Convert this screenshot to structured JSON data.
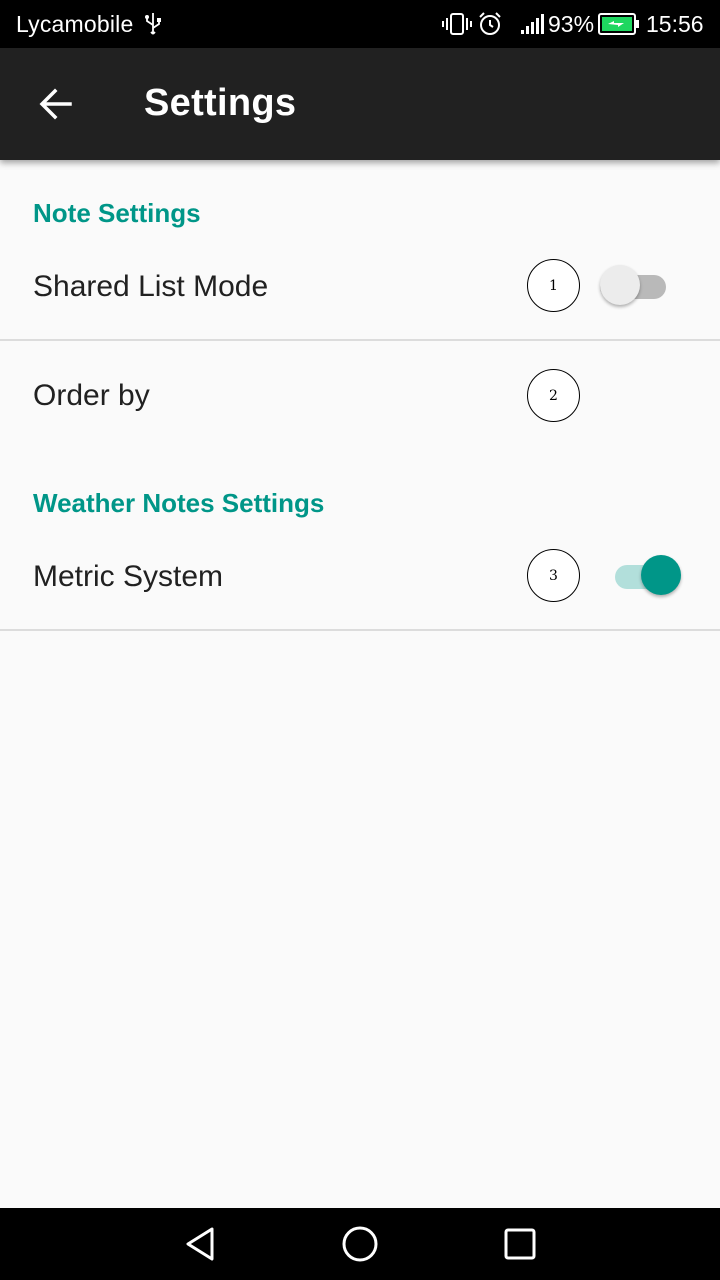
{
  "status_bar": {
    "carrier": "Lycamobile",
    "battery_percent": "93%",
    "time": "15:56",
    "icons": [
      "usb-icon",
      "vibrate-icon",
      "alarm-icon",
      "signal-icon",
      "battery-charging-icon"
    ]
  },
  "app_bar": {
    "back_icon": "arrow-back-icon",
    "title": "Settings"
  },
  "sections": {
    "note": {
      "header": "Note Settings",
      "shared_list_mode": {
        "label": "Shared List Mode",
        "marker": "1",
        "enabled": false
      },
      "order_by": {
        "label": "Order by",
        "marker": "2"
      }
    },
    "weather": {
      "header": "Weather Notes Settings",
      "metric_system": {
        "label": "Metric System",
        "marker": "3",
        "enabled": true
      }
    }
  },
  "nav_bar": {
    "icons": [
      "back-triangle-icon",
      "home-circle-icon",
      "recents-square-icon"
    ]
  },
  "colors": {
    "accent": "#009688",
    "app_bar": "#212121",
    "background": "#fafafa"
  }
}
